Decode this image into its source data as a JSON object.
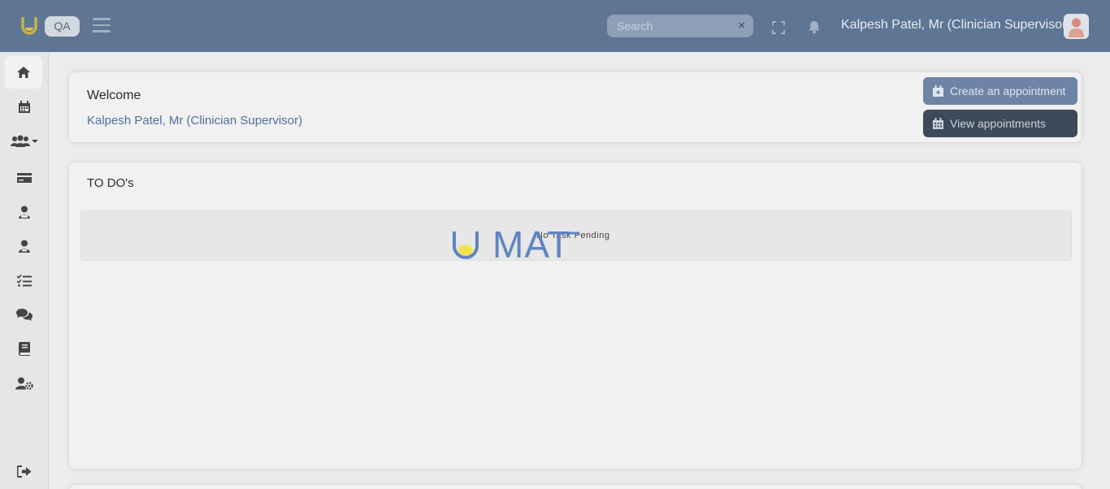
{
  "header": {
    "env_badge": "QA",
    "search_placeholder": "Search",
    "search_clear": "×",
    "user_name": "Kalpesh Patel, Mr (Clinician Supervisor)"
  },
  "sidebar": {
    "items": [
      {
        "name": "home",
        "icon": "home-icon"
      },
      {
        "name": "calendar",
        "icon": "calendar-icon"
      },
      {
        "name": "users",
        "icon": "users-dropdown-icon"
      },
      {
        "name": "billing",
        "icon": "credit-card-icon"
      },
      {
        "name": "clinicians",
        "icon": "user-tie-icon"
      },
      {
        "name": "patients",
        "icon": "user-icon"
      },
      {
        "name": "tasks",
        "icon": "checklist-icon"
      },
      {
        "name": "messages",
        "icon": "chat-icon"
      },
      {
        "name": "library",
        "icon": "book-icon"
      },
      {
        "name": "user-settings",
        "icon": "user-gear-icon"
      },
      {
        "name": "logout",
        "icon": "logout-icon"
      }
    ]
  },
  "welcome": {
    "title": "Welcome",
    "user": "Kalpesh Patel, Mr (Clinician Supervisor)",
    "create_button": "Create an appointment",
    "view_button": "View appointments"
  },
  "todo": {
    "title": "TO DO's",
    "empty_text": "No Task Pending"
  },
  "loader": {
    "brand_text": "MAT",
    "colors": {
      "blue": "#5f84c4",
      "yellow": "#f5e24a"
    }
  },
  "theme": {
    "header_bg": "#5e7594",
    "accent": "#6d84a4"
  }
}
